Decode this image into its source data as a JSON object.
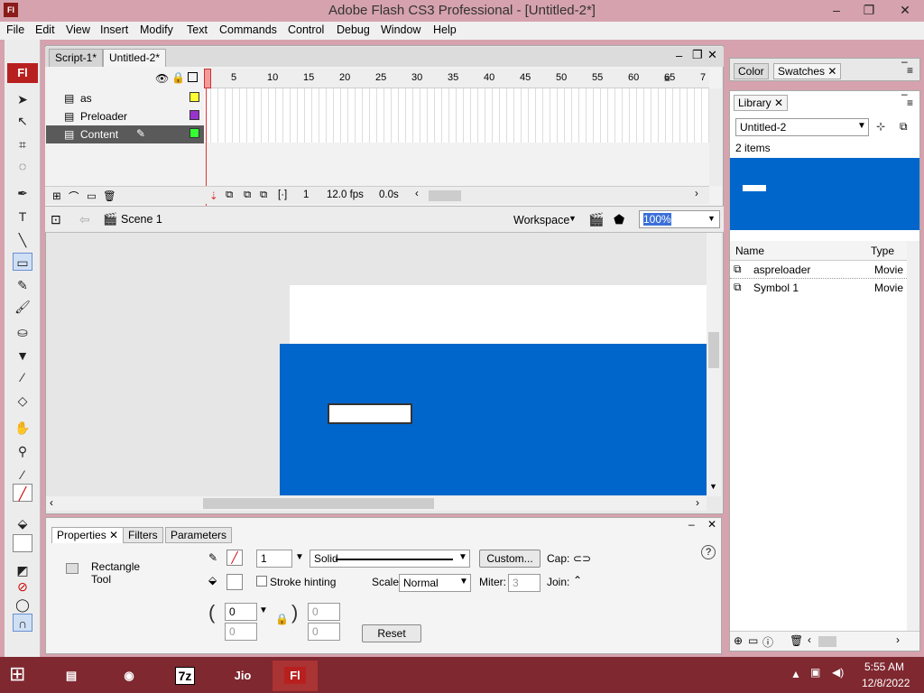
{
  "window": {
    "app_icon": "Fl",
    "title": "Adobe Flash CS3 Professional - [Untitled-2*]",
    "minimize": "–",
    "restore": "❐",
    "close": "✕"
  },
  "menu": [
    "File",
    "Edit",
    "View",
    "Insert",
    "Modify",
    "Text",
    "Commands",
    "Control",
    "Debug",
    "Window",
    "Help"
  ],
  "tools_logo": "Fl",
  "doc_tabs": [
    "Script-1*",
    "Untitled-2*"
  ],
  "timeline": {
    "ruler": [
      "5",
      "10",
      "15",
      "20",
      "25",
      "30",
      "35",
      "40",
      "45",
      "50",
      "55",
      "60",
      "65",
      "7"
    ],
    "layers": [
      {
        "name": "as",
        "color": "#ffff33"
      },
      {
        "name": "Preloader",
        "color": "#9933cc"
      },
      {
        "name": "Content",
        "color": "#33ff33"
      }
    ],
    "frame": "1",
    "fps": "12.0 fps",
    "time": "0.0s"
  },
  "scene": {
    "label": "Scene 1",
    "workspace": "Workspace",
    "zoom": "100%"
  },
  "properties": {
    "tabs": [
      "Properties",
      "Filters",
      "Parameters"
    ],
    "tool_name_line1": "Rectangle",
    "tool_name_line2": "Tool",
    "stroke_size": "1",
    "stroke_style": "Solid",
    "custom_button": "Custom...",
    "cap_label": "Cap:",
    "stroke_hinting": "Stroke hinting",
    "scale_label": "Scale:",
    "scale_value": "Normal",
    "miter_label": "Miter:",
    "miter_value": "3",
    "join_label": "Join:",
    "corner_tl": "0",
    "corner_bl": "0",
    "corner_tr": "0",
    "corner_br": "0",
    "reset": "Reset"
  },
  "right_panels": {
    "color_tab": "Color",
    "swatches_tab": "Swatches",
    "library_tab": "Library",
    "library_doc": "Untitled-2",
    "item_count": "2 items",
    "col_name": "Name",
    "col_type": "Type",
    "items": [
      {
        "name": "aspreloader",
        "type": "Movie"
      },
      {
        "name": "Symbol 1",
        "type": "Movie"
      }
    ]
  },
  "taskbar": {
    "apps": [
      "Explorer",
      "Chrome",
      "7z",
      "Jio",
      "Fl"
    ],
    "time": "5:55 AM",
    "date": "12/8/2022"
  },
  "colors": {
    "accent": "#d5a2ad",
    "stage_blue": "#0066cc",
    "taskbar": "#7f2830"
  }
}
